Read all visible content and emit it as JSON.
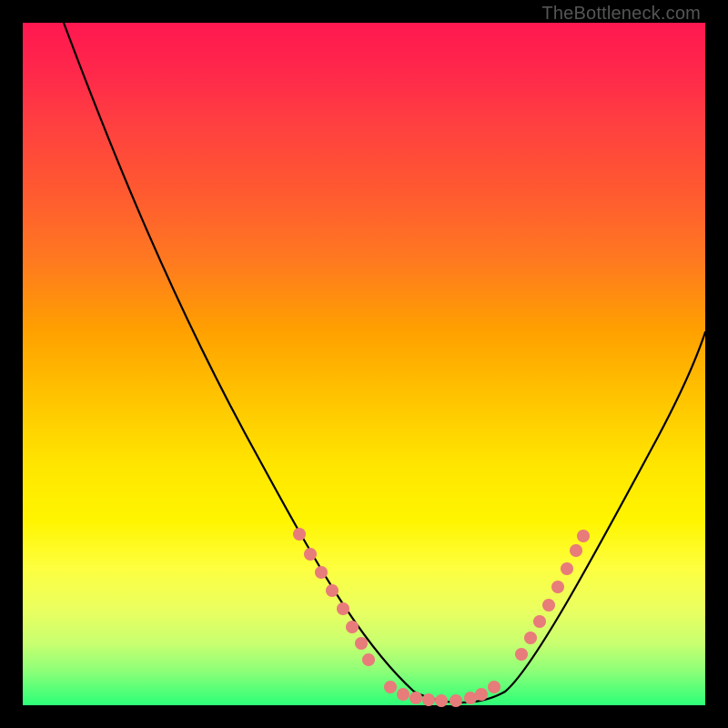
{
  "watermark": "TheBottleneck.com",
  "colors": {
    "frame": "#000000",
    "dot": "#e87c7a",
    "curve": "#000000",
    "gradient_top": "#ff1750",
    "gradient_bottom": "#2cff78"
  },
  "chart_data": {
    "type": "line",
    "title": "",
    "xlabel": "",
    "ylabel": "",
    "xlim": [
      0,
      100
    ],
    "ylim": [
      0,
      100
    ],
    "x": [
      4,
      8,
      12,
      16,
      20,
      24,
      28,
      32,
      36,
      40,
      44,
      48,
      52,
      55,
      58,
      62,
      66,
      70,
      74,
      78,
      82,
      86,
      90,
      94,
      98
    ],
    "values": [
      100,
      92,
      84,
      76,
      68,
      60,
      52,
      44,
      36,
      28,
      21,
      14,
      8,
      4,
      1,
      0,
      0,
      2,
      8,
      16,
      25,
      34,
      42,
      50,
      58
    ],
    "markers": {
      "left_cluster_x": [
        40,
        42,
        44,
        46,
        48,
        50,
        50.5
      ],
      "left_cluster_y": [
        25,
        21,
        17,
        13,
        10,
        7,
        5
      ],
      "bottom_cluster_x": [
        55,
        57,
        59,
        61,
        62,
        64,
        66,
        67,
        68,
        69
      ],
      "bottom_cluster_y": [
        1,
        0.5,
        0.4,
        0.4,
        0.5,
        0.6,
        0.8,
        1.2,
        1.8,
        2.5
      ],
      "right_cluster_x": [
        71,
        73,
        74,
        76,
        77,
        78.5,
        80
      ],
      "right_cluster_y": [
        6,
        9,
        12,
        15,
        18,
        21,
        24
      ]
    }
  }
}
